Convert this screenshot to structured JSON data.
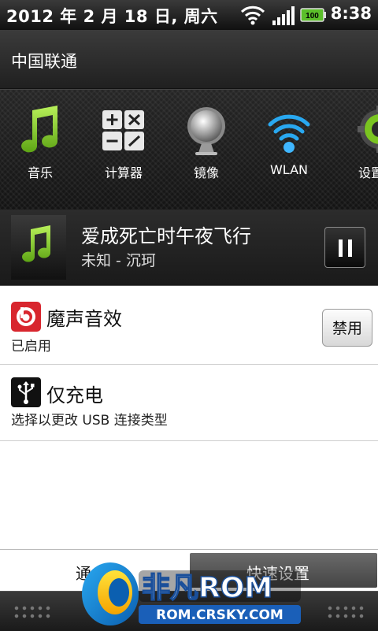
{
  "status_bar": {
    "date": "2012 年 2 月 18 日, 周六",
    "time": "8:38",
    "battery_level": "100",
    "icons": [
      "wifi-icon",
      "signal-icon",
      "battery-icon"
    ]
  },
  "carrier": "中国联通",
  "quick_launch": [
    {
      "label": "音乐",
      "icon": "music-note-icon"
    },
    {
      "label": "计算器",
      "icon": "calculator-icon"
    },
    {
      "label": "镜像",
      "icon": "mirror-icon"
    },
    {
      "label": "WLAN",
      "icon": "wlan-icon"
    },
    {
      "label": "设置",
      "icon": "settings-gear-icon"
    }
  ],
  "music": {
    "title": "爱成死亡时午夜飞行",
    "artist": "未知 - 沉珂",
    "art_icon": "music-note-icon",
    "control_icon": "pause-icon"
  },
  "notifications": [
    {
      "title": "魔声音效",
      "subtitle": "已启用",
      "icon": "beats-audio-icon",
      "button": "禁用"
    },
    {
      "title": "仅充电",
      "subtitle": "选择以更改 USB 连接类型",
      "icon": "usb-icon"
    }
  ],
  "tabs": {
    "left_label": "通",
    "right_label": "快速设置"
  },
  "watermark": {
    "brand": "非凡ROM",
    "url": "ROM.CRSKY.COM"
  },
  "colors": {
    "music_green": "#7ac520",
    "wlan_blue": "#29a8f0",
    "beats_red": "#d8262e"
  }
}
